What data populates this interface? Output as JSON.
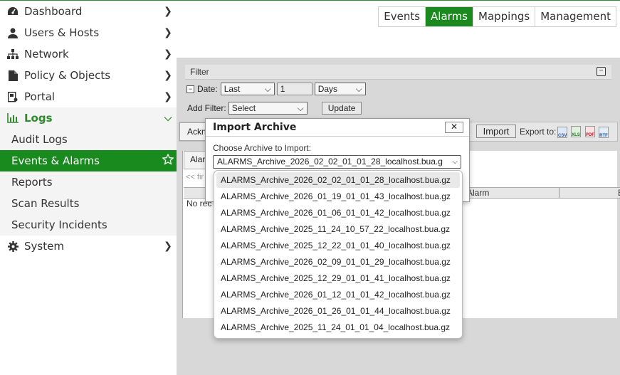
{
  "sidebar": {
    "items": [
      {
        "label": "Dashboard",
        "icon": "dashboard-icon",
        "chevron": "right"
      },
      {
        "label": "Users & Hosts",
        "icon": "user-icon",
        "chevron": "right"
      },
      {
        "label": "Network",
        "icon": "network-icon",
        "chevron": "right"
      },
      {
        "label": "Policy & Objects",
        "icon": "document-icon",
        "chevron": "right"
      },
      {
        "label": "Portal",
        "icon": "portal-icon",
        "chevron": "right"
      },
      {
        "label": "Logs",
        "icon": "bar-chart-icon",
        "chevron": "down"
      },
      {
        "label": "Audit Logs"
      },
      {
        "label": "Events & Alarms",
        "icon_right": "star-icon"
      },
      {
        "label": "Reports"
      },
      {
        "label": "Scan Results"
      },
      {
        "label": "Security Incidents"
      },
      {
        "label": "System",
        "icon": "gear-icon",
        "chevron": "right"
      }
    ]
  },
  "tabs": [
    "Events",
    "Alarms",
    "Mappings",
    "Management"
  ],
  "active_tab": "Alarms",
  "filter": {
    "title": "Filter",
    "date_label": "Date:",
    "date_mode": "Last",
    "date_value": "1",
    "date_unit": "Days",
    "add_filter_label": "Add Filter:",
    "add_filter_value": "Select",
    "update_label": "Update"
  },
  "toolbar": {
    "ack_label": "Ackn",
    "import_label": "Import",
    "export_label": "Export to:",
    "export_formats": [
      "CSV",
      "XLS",
      "PDF",
      "RTF"
    ]
  },
  "grid": {
    "tab_label": "Alar",
    "nav_hint": "<< fir",
    "column_alarm": "Alarm",
    "column_last": "E",
    "empty_text": "No rec"
  },
  "modal": {
    "title": "Import Archive",
    "close_label": "✕",
    "field_label": "Choose Archive to Import:",
    "selected": "ALARMS_Archive_2026_02_02_01_01_28_localhost.bua.g",
    "options": [
      "ALARMS_Archive_2026_02_02_01_01_28_localhost.bua.gz",
      "ALARMS_Archive_2026_01_19_01_01_43_localhost.bua.gz",
      "ALARMS_Archive_2026_01_06_01_01_42_localhost.bua.gz",
      "ALARMS_Archive_2025_11_24_10_57_22_localhost.bua.gz",
      "ALARMS_Archive_2025_12_22_01_01_40_localhost.bua.gz",
      "ALARMS_Archive_2026_02_09_01_01_29_localhost.bua.gz",
      "ALARMS_Archive_2025_12_29_01_01_41_localhost.bua.gz",
      "ALARMS_Archive_2026_01_12_01_01_42_localhost.bua.gz",
      "ALARMS_Archive_2026_01_26_01_01_44_localhost.bua.gz",
      "ALARMS_Archive_2025_11_24_01_01_04_localhost.bua.gz"
    ]
  },
  "colors": {
    "accent": "#188a1e",
    "panel": "#d8d8d8"
  }
}
